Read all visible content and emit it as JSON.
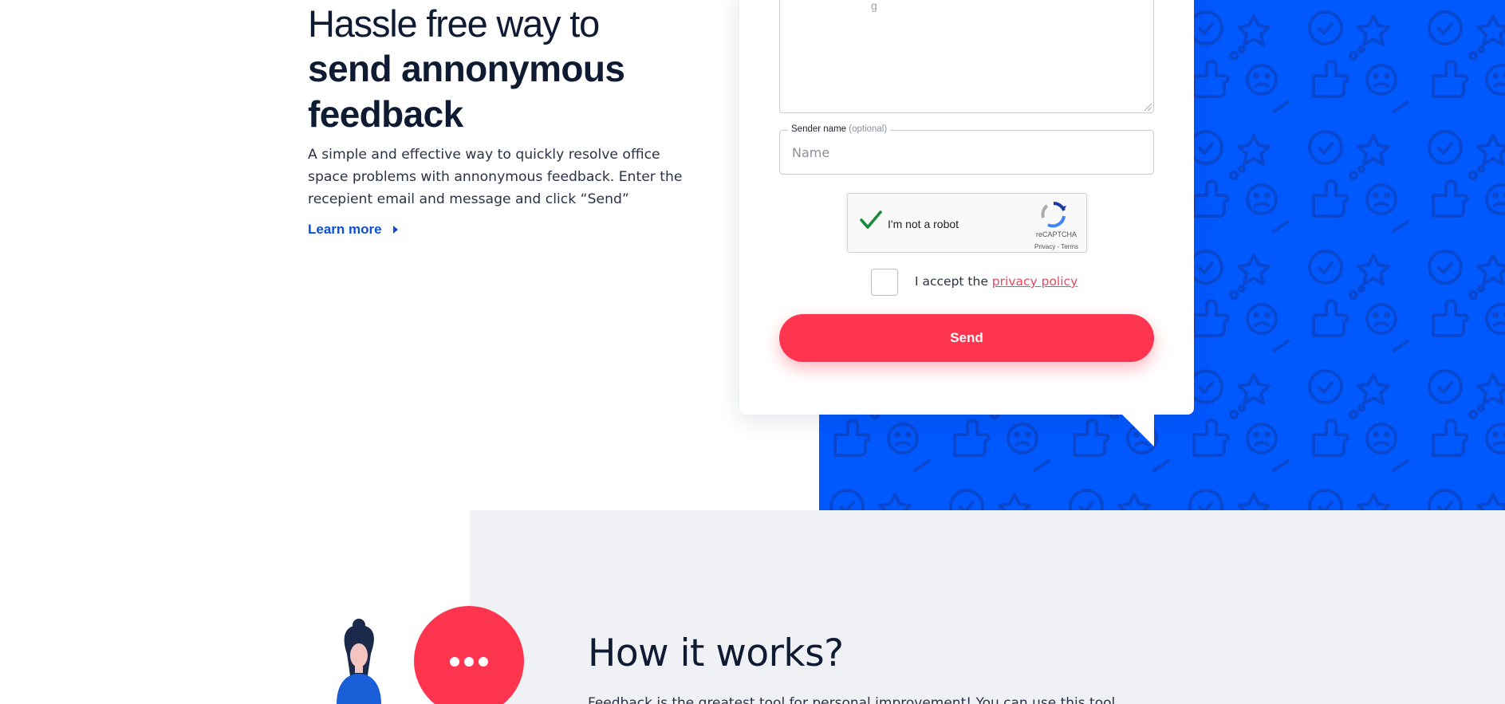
{
  "hero": {
    "title_line1": "Hassle free way to",
    "title_bold": "send annonymous feedback",
    "description": "A simple and effective way to quickly resolve office space problems with annonymous feedback. Enter the recepient email and message and click “Send”",
    "learn_more": "Learn more"
  },
  "form": {
    "message_placeholder_fragment": "g",
    "sender": {
      "label": "Sender name",
      "optional": "(optional)",
      "placeholder": "Name"
    },
    "recaptcha": {
      "label": "I'm not a robot",
      "brand": "reCAPTCHA",
      "terms": "Privacy - Terms"
    },
    "privacy": {
      "prefix": "I accept the",
      "link": "privacy policy"
    },
    "send_label": "Send"
  },
  "how_it_works": {
    "title": "How it works?",
    "description": "Feedback is the greatest tool for personal improvement! You can use this tool"
  },
  "colors": {
    "brand_blue": "#0058ff",
    "accent_red": "#ff3550",
    "gray_bg": "#f0f1f5",
    "text_dark": "#0f1b33"
  }
}
